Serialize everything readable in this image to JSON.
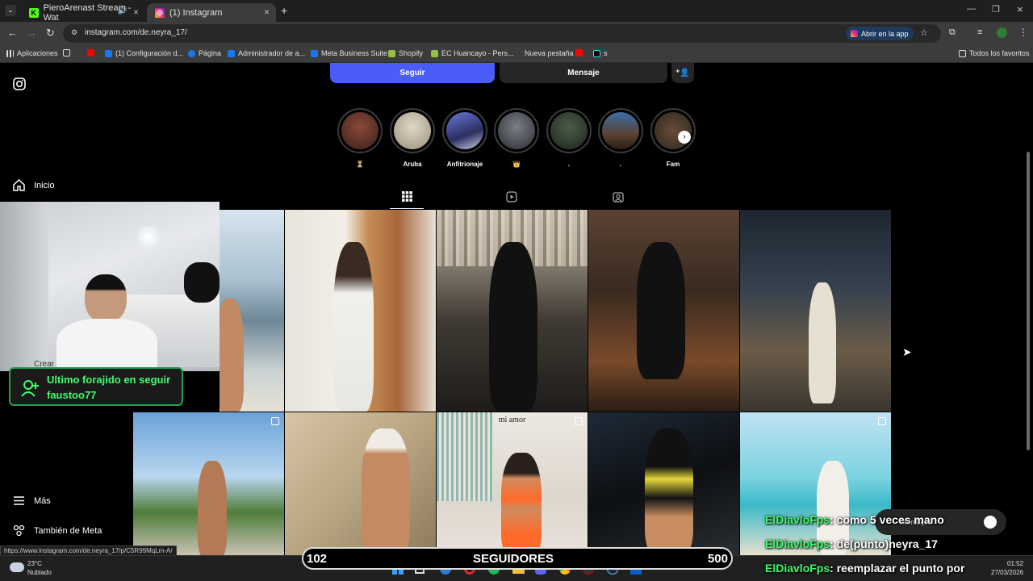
{
  "browser": {
    "tabs": [
      {
        "label": "PieroArenast Stream - Wat",
        "active": false
      },
      {
        "label": "(1) Instagram",
        "active": true
      }
    ],
    "new_tab": "+",
    "url": "instagram.com/de.neyra_17/",
    "open_in_app": "Abrir en la app",
    "bookmarks": [
      "Aplicaciones",
      "(1) Configuración d...",
      "Página",
      "Administrador de a...",
      "Meta Business Suite",
      "Shopify",
      "EC Huancayo - Pers...",
      "Nueva pestaña",
      "s"
    ],
    "all_bookmarks": "Todos los favoritos"
  },
  "profile": {
    "follow_label": "Seguir",
    "message_label": "Mensaje",
    "highlights": [
      "⏳",
      "Aruba",
      "Anfitrionaje",
      "👑",
      ".",
      ".",
      "Fam"
    ]
  },
  "sidebar": {
    "home": "Inicio",
    "create": "Crear",
    "more": "Más",
    "meta": "También de Meta"
  },
  "grid": {
    "caption_tile": "mi amor"
  },
  "stream": {
    "follower_title": "Ultimo forajido en seguir",
    "follower_name": "faustoo77",
    "counter_left": "102",
    "counter_label": "SEGUIDORES",
    "counter_right": "500",
    "messages_label": "Mensajes",
    "chat": [
      {
        "user": "ElDiavloFps",
        "text": "como 5 veces mano"
      },
      {
        "user": "ElDiavloFps",
        "text": "de(punto)neyra_17"
      },
      {
        "user": "ElDiavloFps",
        "text": "reemplazar el punto por"
      }
    ]
  },
  "status_url": "https://www.instagram.com/de.neyra_17/p/C5R99MqLm-A/",
  "taskbar": {
    "weather_temp": "23°C",
    "weather_desc": "Nublado",
    "time": "01:52",
    "date": "27/03/2026"
  },
  "colors": {
    "accent_blue": "#4a5df9",
    "follower_green": "#3cff6a"
  }
}
